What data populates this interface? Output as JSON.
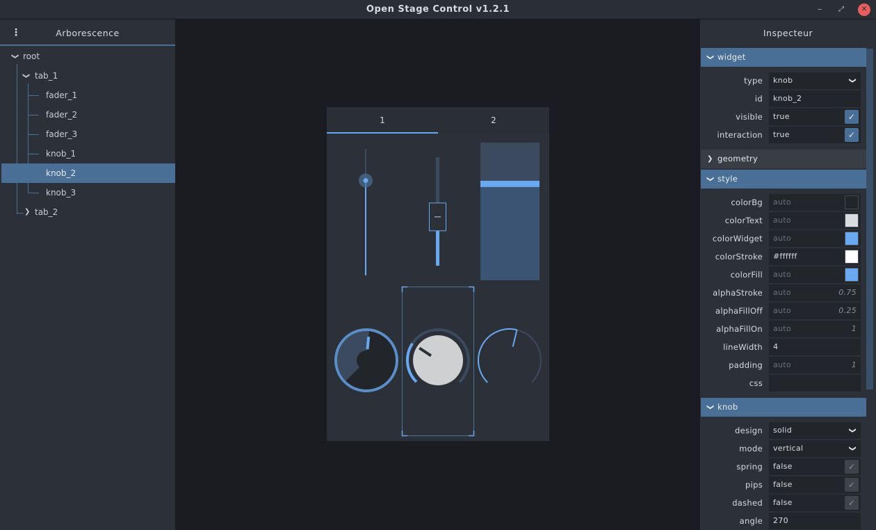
{
  "window": {
    "title": "Open Stage Control v1.2.1",
    "min": "‒",
    "max": "⤢",
    "close": "✕"
  },
  "tree": {
    "title": "Arborescence",
    "menu": "⋮",
    "items": [
      {
        "label": "root",
        "level": 0,
        "expanded": true
      },
      {
        "label": "tab_1",
        "level": 1,
        "expanded": true
      },
      {
        "label": "fader_1",
        "level": 2
      },
      {
        "label": "fader_2",
        "level": 2
      },
      {
        "label": "fader_3",
        "level": 2
      },
      {
        "label": "knob_1",
        "level": 2
      },
      {
        "label": "knob_2",
        "level": 2,
        "selected": true
      },
      {
        "label": "knob_3",
        "level": 2
      },
      {
        "label": "tab_2",
        "level": 1,
        "expanded": false
      }
    ]
  },
  "canvas": {
    "tabs": [
      "1",
      "2"
    ],
    "active_tab": 0,
    "faders": [
      {
        "name": "fader_1",
        "design": "round",
        "value": 0.75
      },
      {
        "name": "fader_2",
        "design": "compact",
        "value": 0.45
      },
      {
        "name": "fader_3",
        "design": "block",
        "value": 0.7
      }
    ],
    "knobs": [
      {
        "name": "knob_1",
        "design": "default",
        "value": 0.52
      },
      {
        "name": "knob_2",
        "design": "solid",
        "value": 0.29,
        "selected": true
      },
      {
        "name": "knob_3",
        "design": "compact",
        "value": 0.55
      }
    ]
  },
  "inspector": {
    "title": "Inspecteur",
    "sections": {
      "widget": "widget",
      "geometry": "geometry",
      "style": "style",
      "knob": "knob"
    },
    "widget": {
      "type": {
        "key": "type",
        "value": "knob",
        "dd": "❯"
      },
      "id": {
        "key": "id",
        "value": "knob_2"
      },
      "visible": {
        "key": "visible",
        "value": "true",
        "check": "✓"
      },
      "interaction": {
        "key": "interaction",
        "value": "true",
        "check": "✓"
      }
    },
    "style": {
      "colorBg": {
        "key": "colorBg",
        "value": "auto",
        "swatch": "#22252a"
      },
      "colorText": {
        "key": "colorText",
        "value": "auto",
        "swatch": "#d8dbe0"
      },
      "colorWidget": {
        "key": "colorWidget",
        "value": "auto",
        "swatch": "#6aa9ef"
      },
      "colorStroke": {
        "key": "colorStroke",
        "value": "#ffffff",
        "swatch": "#ffffff"
      },
      "colorFill": {
        "key": "colorFill",
        "value": "auto",
        "swatch": "#6aa9ef"
      },
      "alphaStroke": {
        "key": "alphaStroke",
        "value": "auto",
        "hint": "0.75"
      },
      "alphaFillOff": {
        "key": "alphaFillOff",
        "value": "auto",
        "hint": "0.25"
      },
      "alphaFillOn": {
        "key": "alphaFillOn",
        "value": "auto",
        "hint": "1"
      },
      "lineWidth": {
        "key": "lineWidth",
        "value": "4"
      },
      "padding": {
        "key": "padding",
        "value": "auto",
        "hint": "1"
      },
      "css": {
        "key": "css",
        "value": ""
      }
    },
    "knob": {
      "design": {
        "key": "design",
        "value": "solid"
      },
      "mode": {
        "key": "mode",
        "value": "vertical"
      },
      "spring": {
        "key": "spring",
        "value": "false",
        "check": "✓"
      },
      "pips": {
        "key": "pips",
        "value": "false",
        "check": "✓"
      },
      "dashed": {
        "key": "dashed",
        "value": "false",
        "check": "✓"
      },
      "angle": {
        "key": "angle",
        "value": "270"
      }
    }
  },
  "colors": {
    "accent": "#6aa9ef",
    "selection": "#4a6f96",
    "panel": "#2c3038",
    "background": "#1a1c21"
  }
}
